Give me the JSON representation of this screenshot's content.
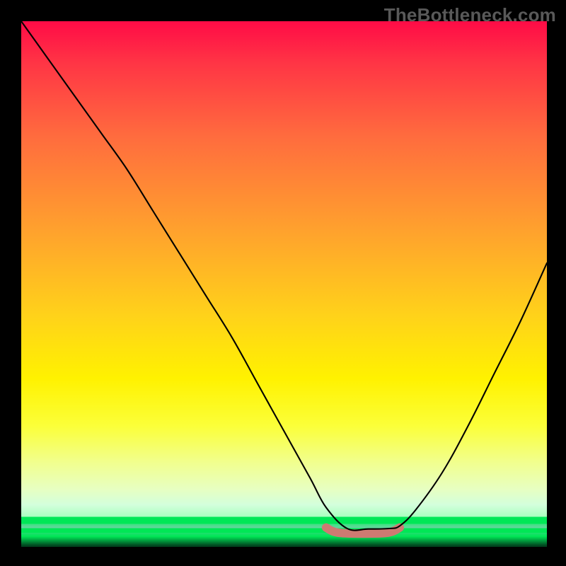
{
  "watermark": "TheBottleneck.com",
  "colors": {
    "background": "#000000",
    "gradient_top": "#ff0b46",
    "gradient_mid": "#fff200",
    "gradient_bottom": "#00e756",
    "curve_stroke": "#000000",
    "bump_stroke": "#CE7A72",
    "watermark_color": "#595959"
  },
  "chart_data": {
    "type": "line",
    "title": "",
    "xlabel": "",
    "ylabel": "",
    "xlim": [
      0,
      100
    ],
    "ylim": [
      0,
      100
    ],
    "series": [
      {
        "name": "bottleneck-curve",
        "x": [
          0,
          5,
          10,
          15,
          20,
          25,
          30,
          35,
          40,
          45,
          50,
          55,
          58,
          62,
          66,
          70,
          72,
          75,
          80,
          85,
          90,
          95,
          100
        ],
        "values": [
          100,
          93,
          86,
          79,
          72,
          64,
          56,
          48,
          40,
          31,
          22,
          13,
          7.5,
          3.5,
          3.4,
          3.5,
          4,
          7,
          14,
          23,
          33,
          43,
          54
        ]
      }
    ],
    "annotations": [
      {
        "name": "optimal-range-marker",
        "shape": "flat-segment",
        "x_start": 58,
        "x_end": 72,
        "y": 3.4,
        "color": "#CE7A72"
      }
    ]
  }
}
